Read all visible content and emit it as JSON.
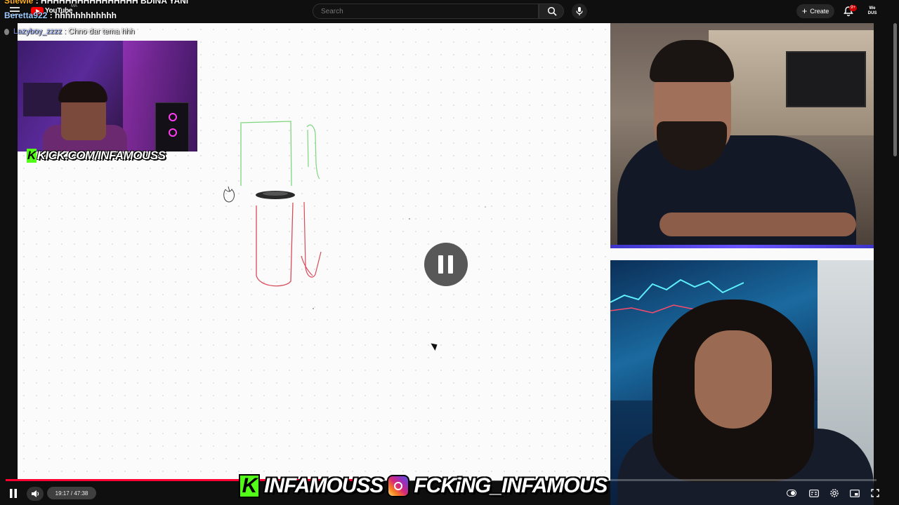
{
  "header": {
    "logo_text": "YouTube",
    "country_code": "MA",
    "search_placeholder": "Search",
    "create_label": "Create",
    "notif_count": "9+",
    "avatar_text": "We\nDUS"
  },
  "chat": [
    {
      "user": "Stiewie",
      "message": " : HHHHHHHHHHHHHHHH BDINA YANI"
    },
    {
      "user": "Beretta922",
      "message": " : hhhhhhhhhhhh"
    },
    {
      "user": "Lazyboy_zzzz",
      "message": " : Chno dar tema hhh"
    }
  ],
  "webcam": {
    "tag": "KICK.COM/INFAMOUSS",
    "tag_badge": "K"
  },
  "player": {
    "time": "19:17 / 47:38",
    "progress": 0.405
  },
  "banner": {
    "kick_badge": "K",
    "kick_name": "INFAMOUSS",
    "instagram_name": "FCKiNG_INFAMOUS"
  },
  "colors": {
    "accent": "#ff0033",
    "kick_green": "#53fc18",
    "drawing_green": "#7ed67e",
    "drawing_red": "#d94a5a"
  },
  "icons": [
    "menu-icon",
    "youtube-logo",
    "search-icon",
    "mic-icon",
    "plus-icon",
    "bell-icon",
    "pause-icon",
    "volume-icon",
    "autoplay-icon",
    "captions-icon",
    "settings-icon",
    "miniplayer-icon",
    "fullscreen-icon",
    "instagram-icon",
    "cursor-icon"
  ]
}
